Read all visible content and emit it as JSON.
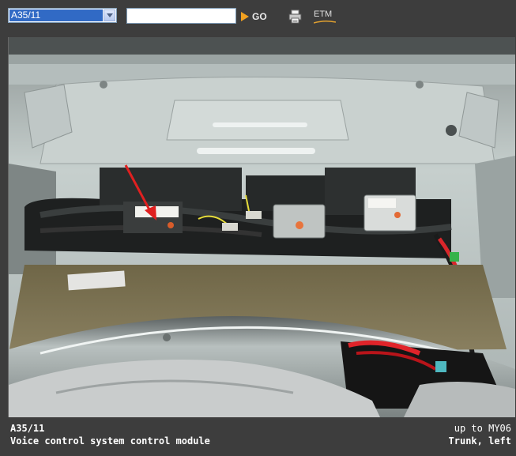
{
  "toolbar": {
    "component_select": {
      "selected": "A35/11"
    },
    "search": {
      "value": "",
      "placeholder": ""
    },
    "go_label": "GO",
    "etm_label": "ETM",
    "icons": {
      "go": "play-arrow-icon",
      "print": "print-icon",
      "dropdown": "chevron-down-icon"
    },
    "colors": {
      "go_arrow": "#f0a020",
      "select_highlight": "#316ac5"
    }
  },
  "photo": {
    "subject": "trunk-component-photo",
    "arrow_color": "#e02020"
  },
  "caption": {
    "code": "A35/11",
    "description": "Voice control system control module",
    "validity": "up to MY06",
    "location": "Trunk, left"
  }
}
